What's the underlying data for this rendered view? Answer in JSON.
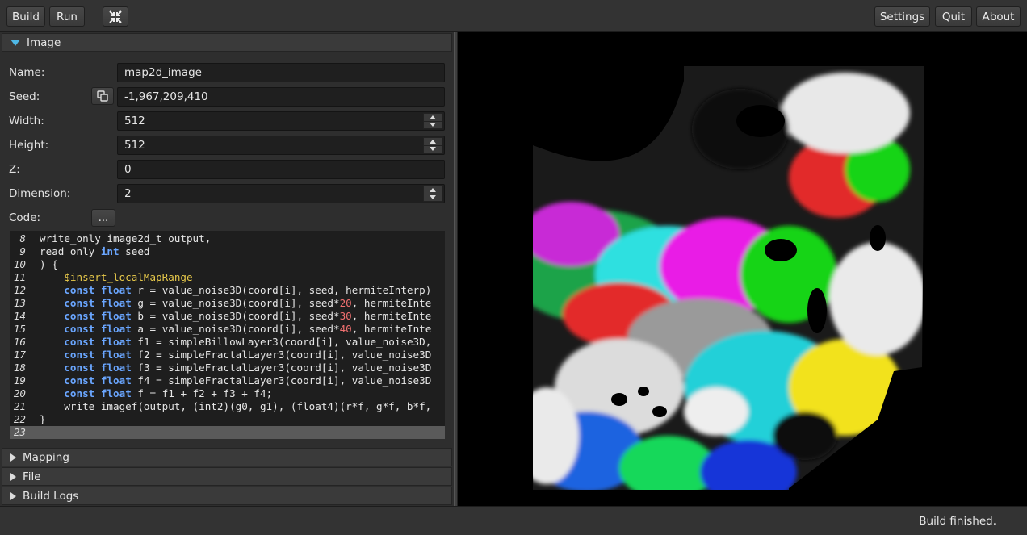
{
  "toolbar": {
    "build_label": "Build",
    "run_label": "Run",
    "compact_icon": "collapse-arrows-icon",
    "settings_label": "Settings",
    "quit_label": "Quit",
    "about_label": "About"
  },
  "image_section": {
    "title": "Image",
    "fields": {
      "name_label": "Name:",
      "name_value": "map2d_image",
      "seed_label": "Seed:",
      "seed_value": "-1,967,209,410",
      "width_label": "Width:",
      "width_value": "512",
      "height_label": "Height:",
      "height_value": "512",
      "z_label": "Z:",
      "z_value": "0",
      "dimension_label": "Dimension:",
      "dimension_value": "2",
      "code_label": "Code:",
      "code_button": "..."
    }
  },
  "code": {
    "lines": [
      {
        "n": "8",
        "t": "write_only image2d_t output,"
      },
      {
        "n": "9",
        "t": "read_only int seed"
      },
      {
        "n": "10",
        "t": ") {"
      },
      {
        "n": "11",
        "t": "    $insert_localMapRange"
      },
      {
        "n": "12",
        "t": "    const float r = value_noise3D(coord[i], seed, hermiteInterp)"
      },
      {
        "n": "13",
        "t": "    const float g = value_noise3D(coord[i], seed*20, hermiteInte"
      },
      {
        "n": "14",
        "t": "    const float b = value_noise3D(coord[i], seed*30, hermiteInte"
      },
      {
        "n": "15",
        "t": "    const float a = value_noise3D(coord[i], seed*40, hermiteInte"
      },
      {
        "n": "16",
        "t": "    const float f1 = simpleBillowLayer3(coord[i], value_noise3D,"
      },
      {
        "n": "17",
        "t": "    const float f2 = simpleFractalLayer3(coord[i], value_noise3D"
      },
      {
        "n": "18",
        "t": "    const float f3 = simpleFractalLayer3(coord[i], value_noise3D"
      },
      {
        "n": "19",
        "t": "    const float f4 = simpleFractalLayer3(coord[i], value_noise3D"
      },
      {
        "n": "20",
        "t": "    const float f = f1 + f2 + f3 + f4;"
      },
      {
        "n": "21",
        "t": "    write_imagef(output, (int2)(g0, g1), (float4)(r*f, g*f, b*f,"
      },
      {
        "n": "22",
        "t": "}"
      },
      {
        "n": "23",
        "t": ""
      }
    ]
  },
  "sections": {
    "mapping": "Mapping",
    "file": "File",
    "build_logs": "Build Logs"
  },
  "status": {
    "text": "Build finished."
  },
  "colors": {
    "keyword": "#6aa6ff",
    "macro": "#e6c84a",
    "number": "#f07070",
    "expander_accent": "#4fb8e6"
  }
}
